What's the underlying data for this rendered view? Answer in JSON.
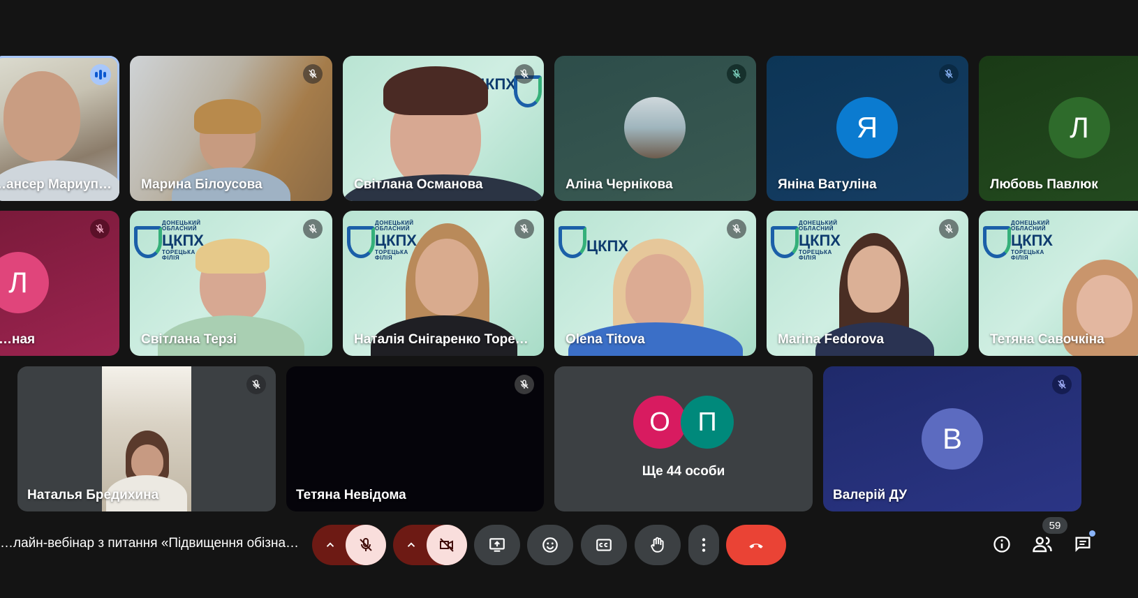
{
  "tiles": {
    "t1": "…ансер Мариуп…",
    "t2": "Марина Білоусова",
    "t3": "Світлана Османова",
    "t4": "Аліна Чернікова",
    "t5": "Яніна Ватуліна",
    "t6": "Любовь Павлюк",
    "t7": "…ная",
    "t8": "Світлана Терзі",
    "t9": "Наталія Снігаренко Торе…",
    "t10": "Olena Titova",
    "t11": "Marina Fedorova",
    "t12": "Тетяна Савочкіна",
    "t13": "Наталья Бредихина",
    "t14": "Тетяна Невідома",
    "t15": "Валерій ДУ"
  },
  "avatars": {
    "t5": "Я",
    "t6": "Л",
    "t7": "Л",
    "t15": "В",
    "more1": "О",
    "more2": "П"
  },
  "colors": {
    "avatar_ya": "#0b7bd0",
    "avatar_l_green": "#2e6b2b",
    "avatar_l_pink": "#e0457b",
    "avatar_v": "#5c6bc0",
    "avatar_o": "#d81b60",
    "avatar_p": "#00897b",
    "hangup": "#ea4335"
  },
  "logo": {
    "line1": "ДОНЕЦЬКИЙ",
    "line2": "ОБЛАСНИЙ",
    "brand": "ЦКПХ",
    "line3": "ТОРЕЦЬКА",
    "line4": "ФІЛІЯ"
  },
  "more_people": "Ще 44 особи",
  "meeting_title": "…лайн-вебінар з питання «Підвищення обізна…",
  "participants_count": "59",
  "icons": {
    "mic_off": "mic-off-icon",
    "cam_off": "camera-off-icon",
    "present": "present-screen-icon",
    "emoji": "emoji-icon",
    "captions": "captions-icon",
    "raise_hand": "raise-hand-icon",
    "more": "more-vert-icon",
    "hangup": "call-end-icon",
    "info": "info-icon",
    "people": "people-icon",
    "chat": "chat-icon"
  }
}
